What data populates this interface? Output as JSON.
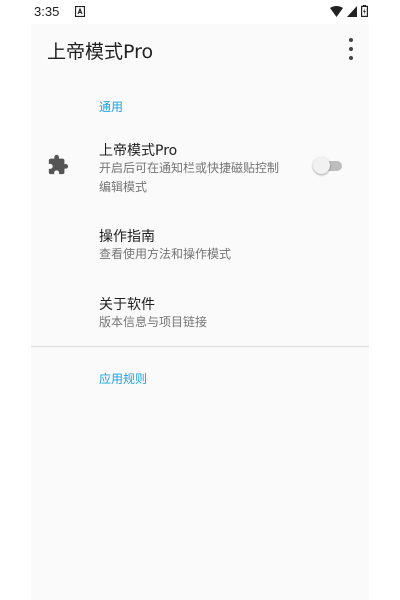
{
  "status_bar": {
    "time": "3:35",
    "icons": [
      "notification-a-icon",
      "wifi-icon",
      "signal-icon",
      "battery-icon"
    ]
  },
  "app_bar": {
    "title": "上帝模式Pro",
    "overflow_icon": "more-vert-icon"
  },
  "sections": [
    {
      "header": "通用",
      "items": [
        {
          "title": "上帝模式Pro",
          "summary": "开启后可在通知栏或快捷磁贴控制编辑模式",
          "icon": "puzzle-icon",
          "switch_on": false
        },
        {
          "title": "操作指南",
          "summary": "查看使用方法和操作模式"
        },
        {
          "title": "关于软件",
          "summary": "版本信息与项目链接"
        }
      ]
    },
    {
      "header": "应用规则",
      "items": []
    }
  ],
  "colors": {
    "accent": "#1ba1e2",
    "background": "#fafafa",
    "text_primary": "#212121",
    "text_secondary": "#757575"
  }
}
